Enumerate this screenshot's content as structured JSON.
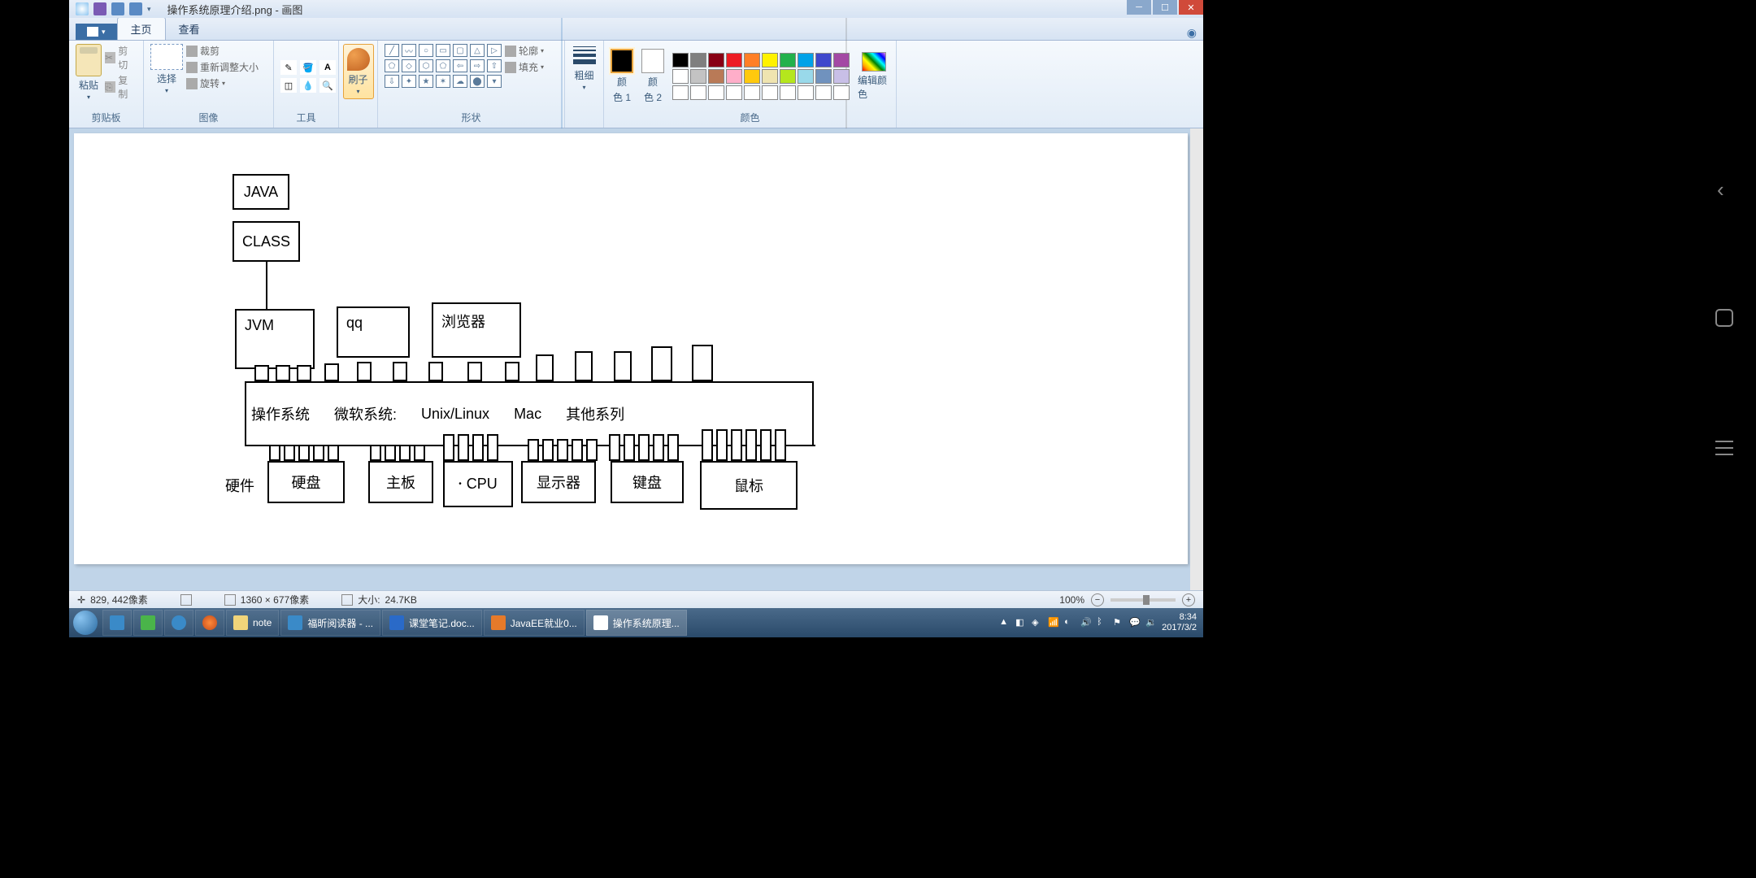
{
  "window": {
    "title": "操作系统原理介绍.png - 画图",
    "app_name": "画图"
  },
  "tabs": {
    "file": "",
    "home": "主页",
    "view": "查看"
  },
  "ribbon": {
    "clipboard": {
      "label": "剪贴板",
      "paste": "粘贴",
      "cut": "剪切",
      "copy": "复制"
    },
    "image": {
      "label": "图像",
      "select": "选择",
      "crop": "裁剪",
      "resize": "重新调整大小",
      "rotate": "旋转"
    },
    "tools": {
      "label": "工具"
    },
    "brush": {
      "label": "刷子"
    },
    "shapes": {
      "label": "形状",
      "outline": "轮廓",
      "fill": "填充"
    },
    "thickness": {
      "label": "粗细"
    },
    "color1": {
      "top": "颜",
      "bottom": "色 1"
    },
    "color2": {
      "top": "颜",
      "bottom": "色 2"
    },
    "colors_label": "颜色",
    "edit_colors": "编辑颜色"
  },
  "palette": {
    "row1": [
      "#000000",
      "#7f7f7f",
      "#880015",
      "#ed1c24",
      "#ff7f27",
      "#fff200",
      "#22b14c",
      "#00a2e8",
      "#3f48cc",
      "#a349a4"
    ],
    "row2": [
      "#ffffff",
      "#c3c3c3",
      "#b97a57",
      "#ffaec9",
      "#ffc90e",
      "#efe4b0",
      "#b5e61d",
      "#99d9ea",
      "#7092be",
      "#c8bfe7"
    ],
    "row3": [
      "#ffffff",
      "#ffffff",
      "#ffffff",
      "#ffffff",
      "#ffffff",
      "#ffffff",
      "#ffffff",
      "#ffffff",
      "#ffffff",
      "#ffffff"
    ]
  },
  "diagram": {
    "java": "JAVA",
    "class": "CLASS",
    "jvm": "JVM",
    "qq": "qq",
    "browser": "浏览器",
    "os": "操作系统",
    "ms": "微软系统:",
    "unix": "Unix/Linux",
    "mac": "Mac",
    "other": "其他系列",
    "hardware": "硬件",
    "hdd": "硬盘",
    "mobo": "主板",
    "cpu": "CPU",
    "monitor": "显示器",
    "keyboard": "键盘",
    "mouse": "鼠标"
  },
  "status": {
    "coords": "829, 442像素",
    "size": "1360 × 677像素",
    "filesize_label": "大小:",
    "filesize": "24.7KB",
    "zoom": "100%"
  },
  "taskbar": {
    "items": [
      "",
      "",
      "",
      "",
      "",
      "note",
      "福昕阅读器 - ...",
      "课堂笔记.doc...",
      "JavaEE就业0...",
      "操作系统原理..."
    ],
    "time": "8:34",
    "date": "2017/3/2"
  }
}
